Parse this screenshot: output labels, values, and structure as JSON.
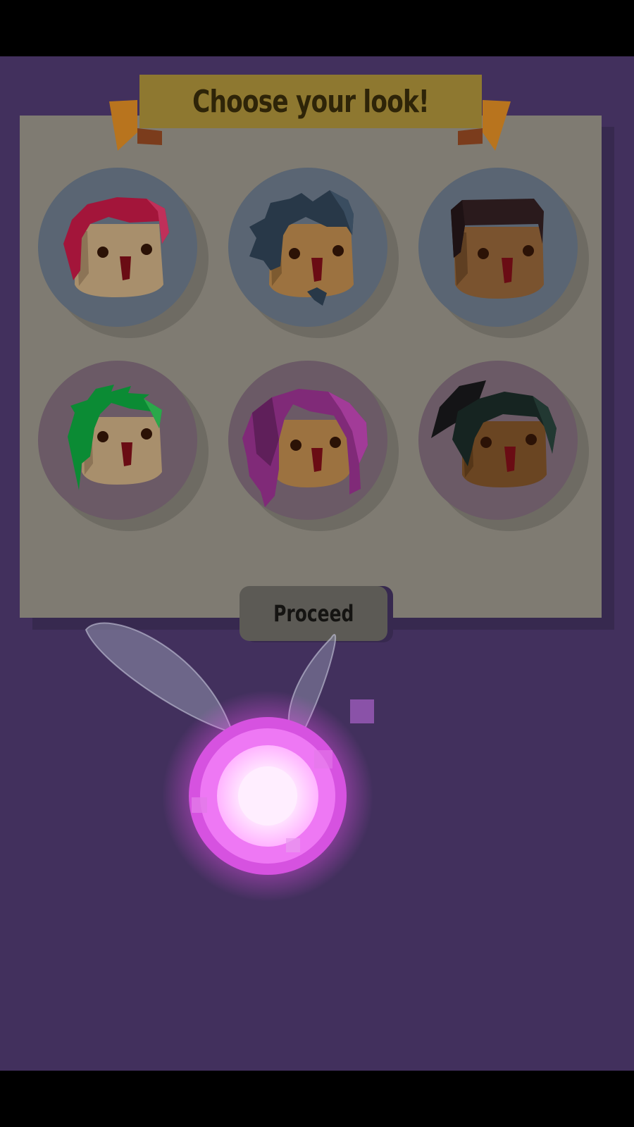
{
  "title": "Choose your look!",
  "proceed_label": "Proceed",
  "colors": {
    "background": "#42305d",
    "panel": "#7f7b72",
    "banner": "#8e7830",
    "banner_tails": "#b8741e",
    "disc_male": "#5a6573",
    "disc_female": "#6b5a66",
    "fairy_glow": "#ff66ff"
  },
  "avatars": [
    {
      "id": "avatar-1",
      "hair": "red-spiky",
      "hair_color": "#a3153a",
      "skin": "#a88f6c"
    },
    {
      "id": "avatar-2",
      "hair": "blue-spiky-goatee",
      "hair_color": "#283848",
      "skin": "#9c7240"
    },
    {
      "id": "avatar-3",
      "hair": "dark-flat-top",
      "hair_color": "#2a1a1c",
      "skin": "#7a532f"
    },
    {
      "id": "avatar-4",
      "hair": "green-side-swept",
      "hair_color": "#0b8b34",
      "skin": "#a88f6c"
    },
    {
      "id": "avatar-5",
      "hair": "magenta-long",
      "hair_color": "#802a78",
      "skin": "#9c7240"
    },
    {
      "id": "avatar-6",
      "hair": "black-ponytail",
      "hair_color": "#162421",
      "skin": "#6a4522"
    }
  ]
}
